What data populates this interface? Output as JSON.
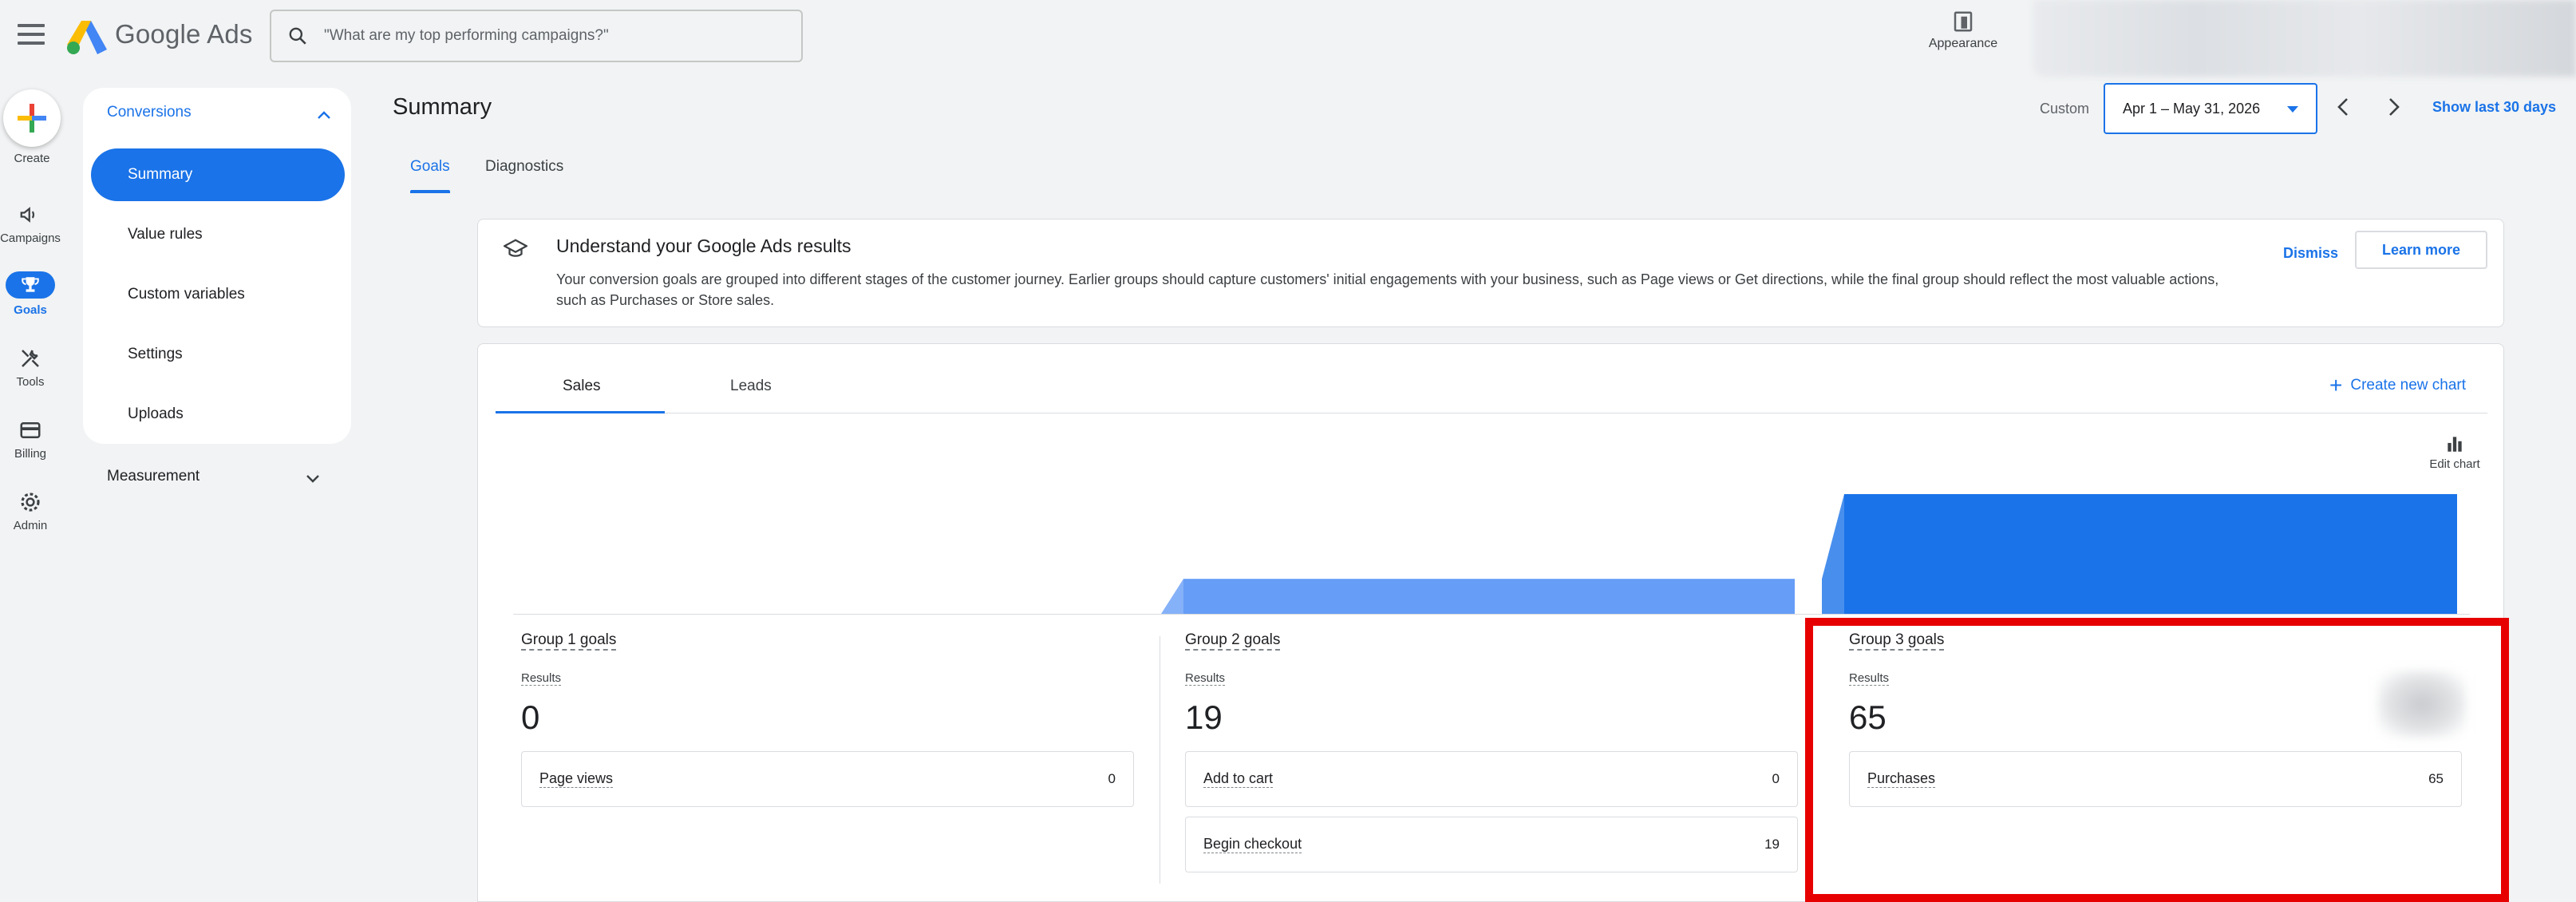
{
  "app": {
    "brand": "Google Ads",
    "search_placeholder": "\"What are my top performing campaigns?\"",
    "appearance_label": "Appearance"
  },
  "rail": {
    "create_label": "Create",
    "items": [
      {
        "label": "Campaigns",
        "icon": "megaphone-icon"
      },
      {
        "label": "Goals",
        "icon": "trophy-icon",
        "active": true
      },
      {
        "label": "Tools",
        "icon": "wrench-icon"
      },
      {
        "label": "Billing",
        "icon": "credit-card-icon"
      },
      {
        "label": "Admin",
        "icon": "gear-icon"
      }
    ]
  },
  "subnav": {
    "section": "Conversions",
    "items": [
      "Summary",
      "Value rules",
      "Custom variables",
      "Settings",
      "Uploads"
    ],
    "active_item": "Summary",
    "measurement": "Measurement"
  },
  "header": {
    "title": "Summary",
    "custom_label": "Custom",
    "date_range": "Apr 1 – May 31, 2026",
    "show_last": "Show last 30 days"
  },
  "tabs": {
    "goals": "Goals",
    "diagnostics": "Diagnostics",
    "active": "Goals"
  },
  "banner": {
    "title": "Understand your Google Ads results",
    "body": "Your conversion goals are grouped into different stages of the customer journey. Earlier groups should capture customers' initial engagements with your business, such as Page views or Get directions, while the final group should reflect the most valuable actions, such as Purchases or Store sales.",
    "dismiss": "Dismiss",
    "learn_more": "Learn more"
  },
  "card": {
    "tab_sales": "Sales",
    "tab_leads": "Leads",
    "active_tab": "Sales",
    "create_chart": "Create new chart",
    "edit_chart": "Edit chart"
  },
  "chart_data": {
    "type": "area",
    "categories": [
      "Group 1 goals",
      "Group 2 goals",
      "Group 3 goals"
    ],
    "values": [
      0,
      19,
      65
    ],
    "colors": [
      "#669df6",
      "#669df6",
      "#1a73e8"
    ]
  },
  "groups": [
    {
      "title": "Group 1 goals",
      "results_label": "Results",
      "results": "0",
      "conversions": [
        {
          "name": "Page views",
          "value": "0"
        }
      ]
    },
    {
      "title": "Group 2 goals",
      "results_label": "Results",
      "results": "19",
      "conversions": [
        {
          "name": "Add to cart",
          "value": "0"
        },
        {
          "name": "Begin checkout",
          "value": "19"
        }
      ]
    },
    {
      "title": "Group 3 goals",
      "results_label": "Results",
      "results": "65",
      "conversions": [
        {
          "name": "Purchases",
          "value": "65"
        }
      ]
    }
  ],
  "colors": {
    "accent": "#1a73e8",
    "highlight": "#e60000"
  }
}
